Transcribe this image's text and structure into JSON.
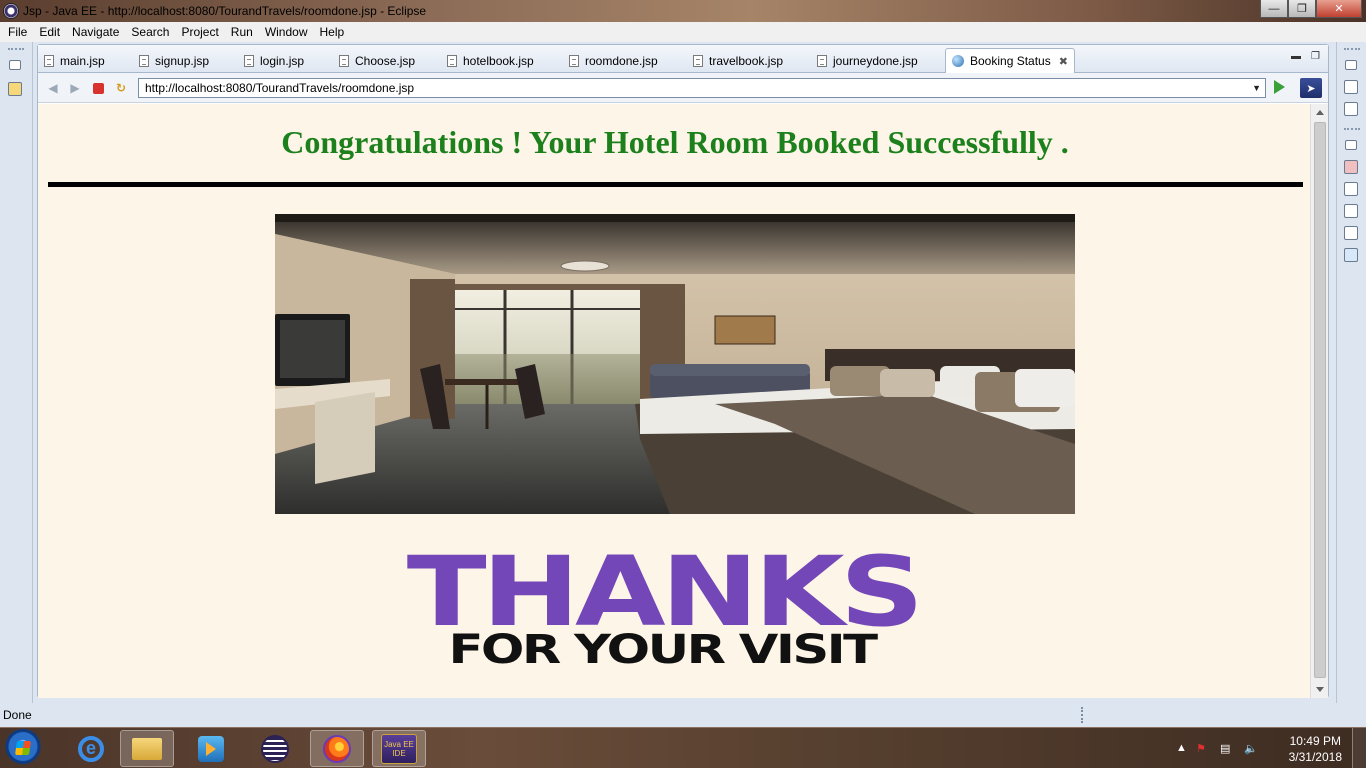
{
  "window": {
    "title": "Jsp - Java EE - http://localhost:8080/TourandTravels/roomdone.jsp - Eclipse",
    "minimize_icon": "minimize-icon",
    "maximize_icon": "restore-icon",
    "close_icon": "close-icon"
  },
  "menubar": {
    "items": [
      "File",
      "Edit",
      "Navigate",
      "Search",
      "Project",
      "Run",
      "Window",
      "Help"
    ]
  },
  "tabs": [
    {
      "label": "main.jsp",
      "icon": "jsp-file-icon"
    },
    {
      "label": "signup.jsp",
      "icon": "jsp-file-icon"
    },
    {
      "label": "login.jsp",
      "icon": "jsp-file-icon"
    },
    {
      "label": "Choose.jsp",
      "icon": "jsp-file-icon"
    },
    {
      "label": "hotelbook.jsp",
      "icon": "jsp-file-icon"
    },
    {
      "label": "roomdone.jsp",
      "icon": "jsp-file-icon"
    },
    {
      "label": "travelbook.jsp",
      "icon": "jsp-file-icon"
    },
    {
      "label": "journeydone.jsp",
      "icon": "jsp-file-icon"
    },
    {
      "label": "Booking Status",
      "icon": "globe-icon",
      "active": true
    }
  ],
  "browser": {
    "url": "http://localhost:8080/TourandTravels/roomdone.jsp"
  },
  "page": {
    "headline": "Congratulations ! Your Hotel Room Booked Successfully .",
    "thanks_big": "THANKS",
    "thanks_small": "FOR YOUR VISIT",
    "headline_color": "#1c801c",
    "thanks_color": "#7447b8",
    "background": "#fdf5e7"
  },
  "statusbar": {
    "text": "Done"
  },
  "taskbar": {
    "apps": [
      "internet-explorer-icon",
      "file-explorer-icon",
      "media-player-icon",
      "eclipse-icon",
      "firefox-icon",
      "java-ee-ide-icon"
    ],
    "jee_label": "Java EE IDE",
    "time": "10:49 PM",
    "date": "3/31/2018"
  }
}
